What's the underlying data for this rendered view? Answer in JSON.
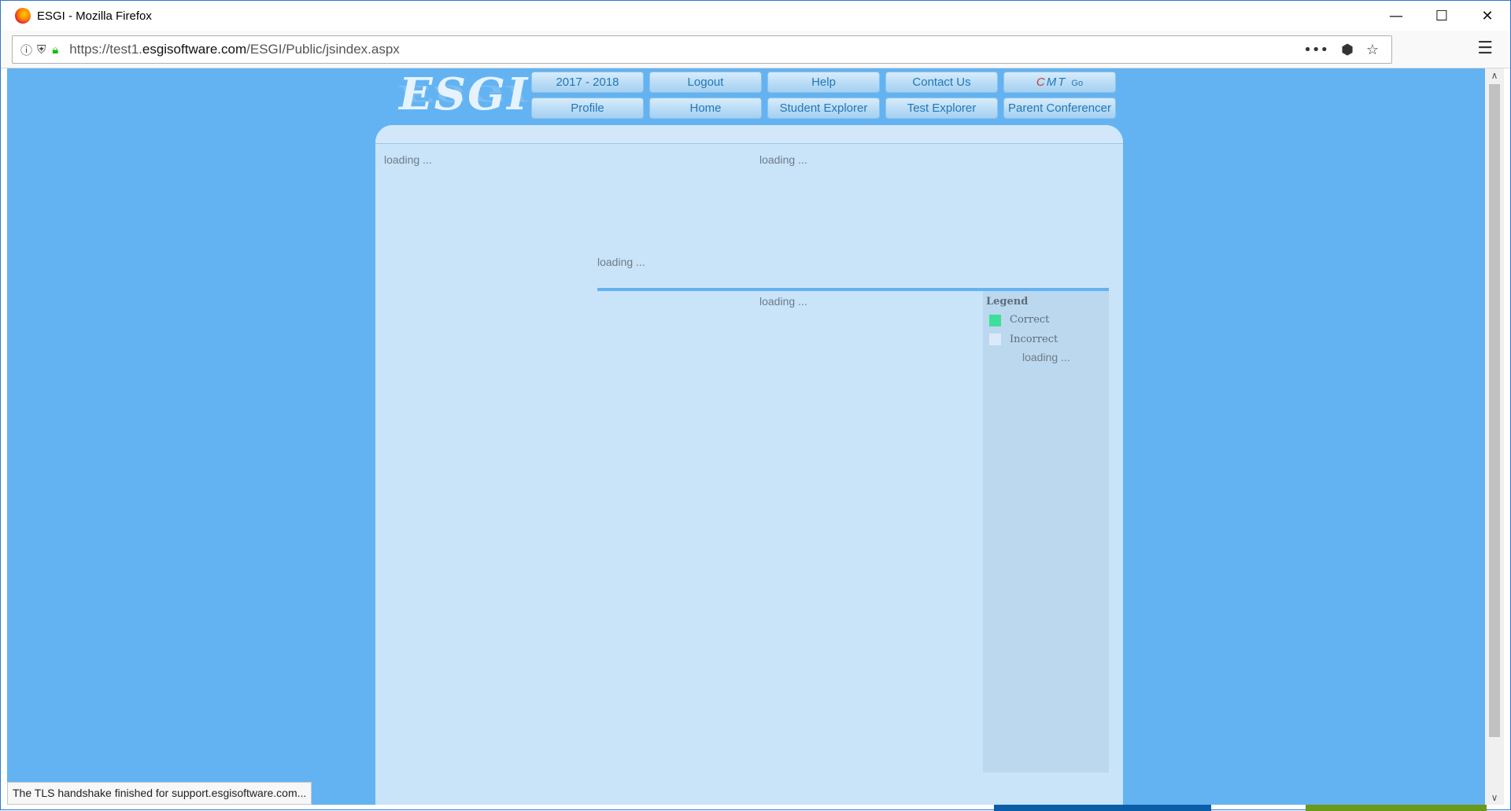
{
  "browser": {
    "window_title": "ESGI - Mozilla Firefox",
    "url_prefix": "https://test1.",
    "url_host": "esgisoftware.com",
    "url_path": "/ESGI/Public/jsindex.aspx",
    "status_text": "The TLS handshake finished for support.esgisoftware.com..."
  },
  "header": {
    "logo_text": "ESGI",
    "nav_row1": [
      "2017 - 2018",
      "Logout",
      "Help",
      "Contact Us"
    ],
    "cmt_label_c": "C",
    "cmt_label_mt": "MT",
    "cmt_go": "Go",
    "nav_row2": [
      "Profile",
      "Home",
      "Student Explorer",
      "Test Explorer",
      "Parent Conferencer"
    ]
  },
  "panel": {
    "loading_top_left": "loading ...",
    "loading_top_right": "loading ...",
    "loading_mid": "loading ...",
    "loading_chart": "loading ...",
    "legend": {
      "title": "Legend",
      "items": [
        {
          "label": "Correct",
          "color": "#3ddf9a"
        },
        {
          "label": "Incorrect",
          "color": "#dbeafa"
        }
      ],
      "loading": "loading ..."
    }
  },
  "colors": {
    "page_background": "#63b3f2",
    "panel_background": "#c9e3f8",
    "button_text": "#2277b8"
  }
}
